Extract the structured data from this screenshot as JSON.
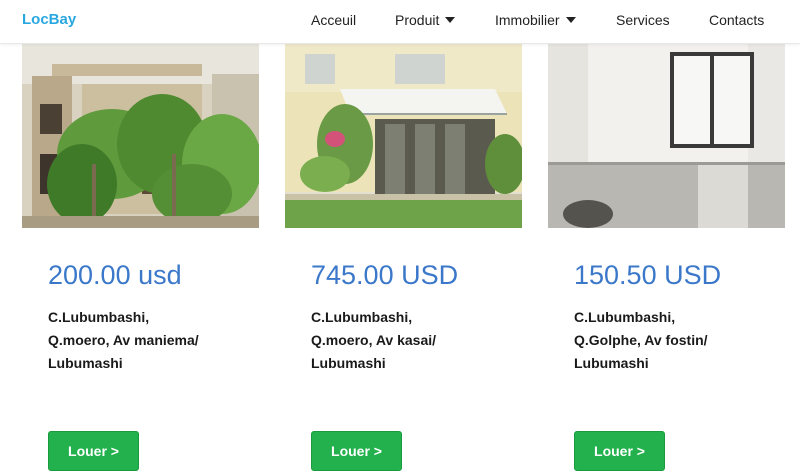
{
  "nav": {
    "brand": "LocBay",
    "items": [
      {
        "label": "Acceuil",
        "dropdown": false
      },
      {
        "label": "Produit",
        "dropdown": true
      },
      {
        "label": "Immobilier",
        "dropdown": true
      },
      {
        "label": "Services",
        "dropdown": false
      },
      {
        "label": "Contacts",
        "dropdown": false
      }
    ]
  },
  "colors": {
    "brand": "#29a8e0",
    "price": "#3b78c9",
    "button": "#22b14c"
  },
  "listings": [
    {
      "price": "200.00 usd",
      "address": [
        "C.Lubumbashi,",
        "Q.moero, Av maniema/",
        "Lubumashi"
      ],
      "button": "Louer >"
    },
    {
      "price": "745.00 USD",
      "address": [
        "C.Lubumbashi,",
        "Q.moero, Av kasai/",
        "Lubumashi"
      ],
      "button": "Louer >"
    },
    {
      "price": "150.50 USD",
      "address": [
        "C.Lubumbashi,",
        "Q.Golphe, Av fostin/",
        "Lubumashi"
      ],
      "button": "Louer >"
    }
  ]
}
